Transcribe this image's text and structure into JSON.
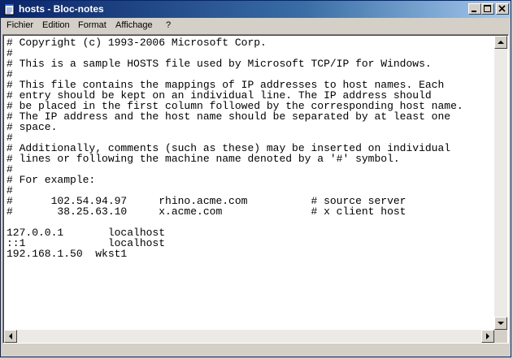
{
  "window": {
    "title": "hosts - Bloc-notes",
    "icon": "notepad-icon"
  },
  "title_buttons": {
    "minimize": "minimize-icon",
    "maximize": "maximize-icon",
    "close": "close-icon"
  },
  "menu": {
    "items": [
      "Fichier",
      "Edition",
      "Format",
      "Affichage",
      "?"
    ]
  },
  "editor": {
    "content": "# Copyright (c) 1993-2006 Microsoft Corp.\n#\n# This is a sample HOSTS file used by Microsoft TCP/IP for Windows.\n#\n# This file contains the mappings of IP addresses to host names. Each\n# entry should be kept on an individual line. The IP address should\n# be placed in the first column followed by the corresponding host name.\n# The IP address and the host name should be separated by at least one\n# space.\n#\n# Additionally, comments (such as these) may be inserted on individual\n# lines or following the machine name denoted by a '#' symbol.\n#\n# For example:\n#\n#      102.54.94.97     rhino.acme.com          # source server\n#       38.25.63.10     x.acme.com              # x client host\n\n127.0.0.1       localhost\n::1             localhost\n192.168.1.50  wkst1"
  },
  "scrollbars": {
    "up": "scroll-up-arrow-icon",
    "down": "scroll-down-arrow-icon",
    "left": "scroll-left-arrow-icon",
    "right": "scroll-right-arrow-icon"
  }
}
